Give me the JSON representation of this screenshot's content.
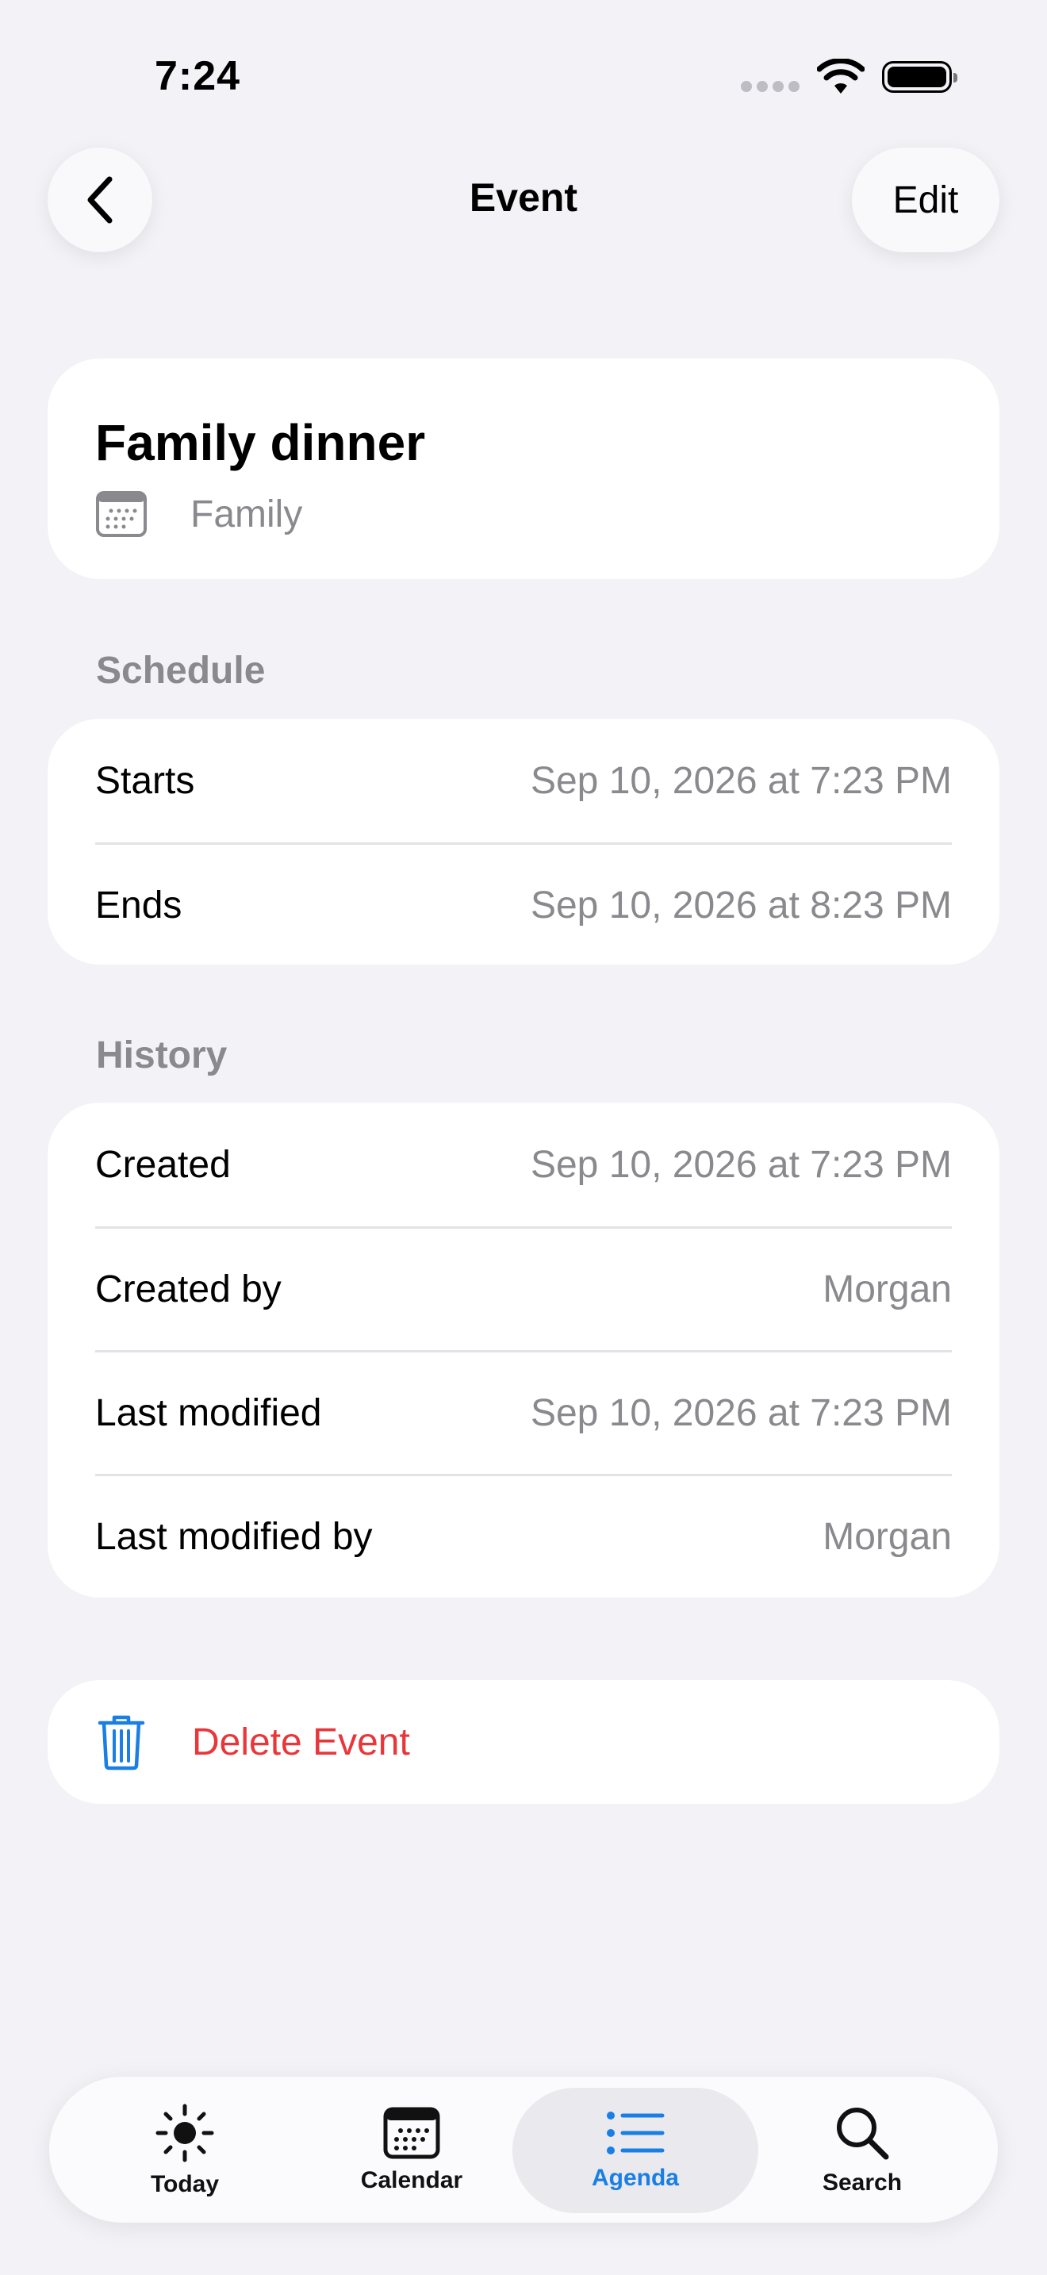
{
  "status_bar": {
    "time": "7:24"
  },
  "nav": {
    "title": "Event",
    "edit_label": "Edit"
  },
  "event": {
    "title": "Family dinner",
    "calendar": "Family"
  },
  "schedule": {
    "header": "Schedule",
    "rows": [
      {
        "label": "Starts",
        "value": "Sep 10, 2026 at 7:23 PM"
      },
      {
        "label": "Ends",
        "value": "Sep 10, 2026 at 8:23 PM"
      }
    ]
  },
  "history": {
    "header": "History",
    "rows": [
      {
        "label": "Created",
        "value": "Sep 10, 2026 at 7:23 PM"
      },
      {
        "label": "Created by",
        "value": "Morgan"
      },
      {
        "label": "Last modified",
        "value": "Sep 10, 2026 at 7:23 PM"
      },
      {
        "label": "Last modified by",
        "value": "Morgan"
      }
    ]
  },
  "delete": {
    "label": "Delete Event"
  },
  "tabs": [
    {
      "label": "Today",
      "icon": "sun-icon"
    },
    {
      "label": "Calendar",
      "icon": "calendar-icon"
    },
    {
      "label": "Agenda",
      "icon": "list-icon",
      "active": true
    },
    {
      "label": "Search",
      "icon": "magnifier-icon"
    }
  ],
  "colors": {
    "accent": "#1a7fe4",
    "destructive": "#e8363a",
    "secondary_text": "#8a8a8e",
    "background": "#f2f2f7"
  }
}
